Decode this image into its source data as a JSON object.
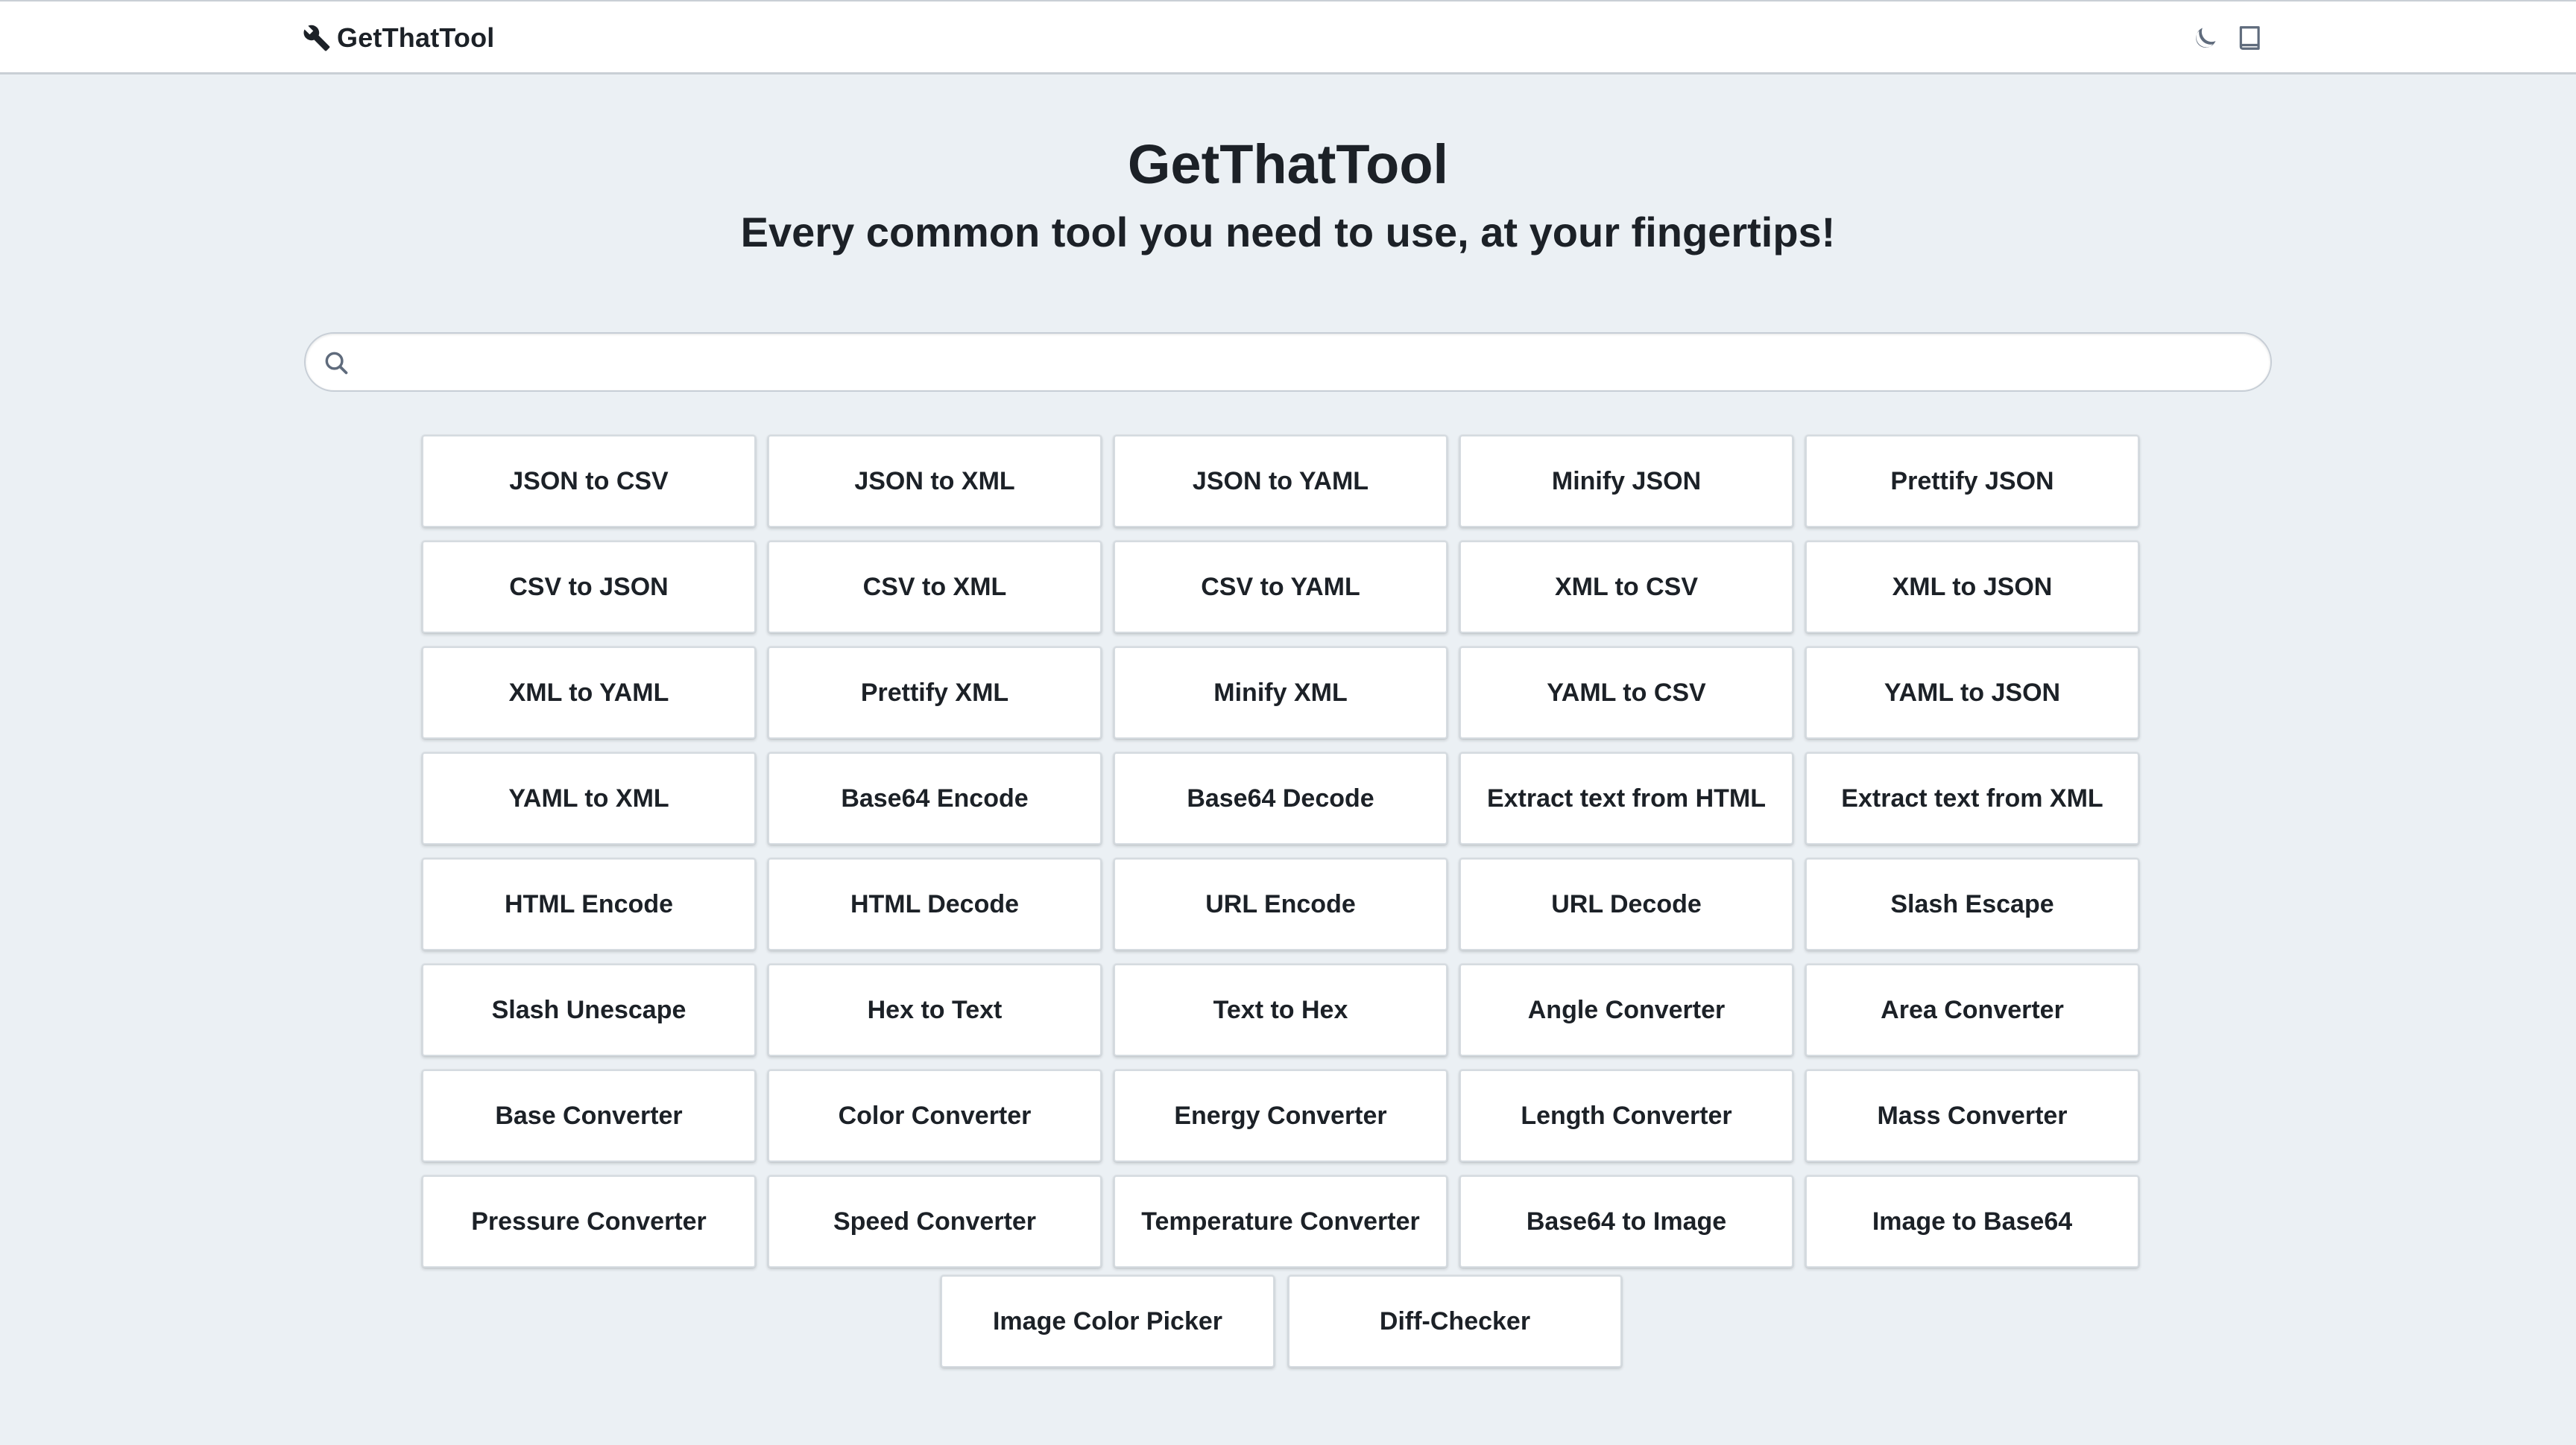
{
  "header": {
    "brand": "GetThatTool",
    "icons": [
      "wrench-icon",
      "moon-icon",
      "book-icon"
    ]
  },
  "hero": {
    "title": "GetThatTool",
    "subtitle": "Every common tool you need to use, at your fingertips!"
  },
  "search": {
    "placeholder": "",
    "value": ""
  },
  "tools": [
    "JSON to CSV",
    "JSON to XML",
    "JSON to YAML",
    "Minify JSON",
    "Prettify JSON",
    "CSV to JSON",
    "CSV to XML",
    "CSV to YAML",
    "XML to CSV",
    "XML to JSON",
    "XML to YAML",
    "Prettify XML",
    "Minify XML",
    "YAML to CSV",
    "YAML to JSON",
    "YAML to XML",
    "Base64 Encode",
    "Base64 Decode",
    "Extract text from HTML",
    "Extract text from XML",
    "HTML Encode",
    "HTML Decode",
    "URL Encode",
    "URL Decode",
    "Slash Escape",
    "Slash Unescape",
    "Hex to Text",
    "Text to Hex",
    "Angle Converter",
    "Area Converter",
    "Base Converter",
    "Color Converter",
    "Energy Converter",
    "Length Converter",
    "Mass Converter",
    "Pressure Converter",
    "Speed Converter",
    "Temperature Converter",
    "Base64 to Image",
    "Image to Base64",
    "Image Color Picker",
    "Diff-Checker"
  ],
  "colors": {
    "background": "#ebf0f4",
    "header_bg": "#ffffff",
    "tile_bg": "#ffffff",
    "text": "#1c2127",
    "icon": "#5f6b7c"
  }
}
